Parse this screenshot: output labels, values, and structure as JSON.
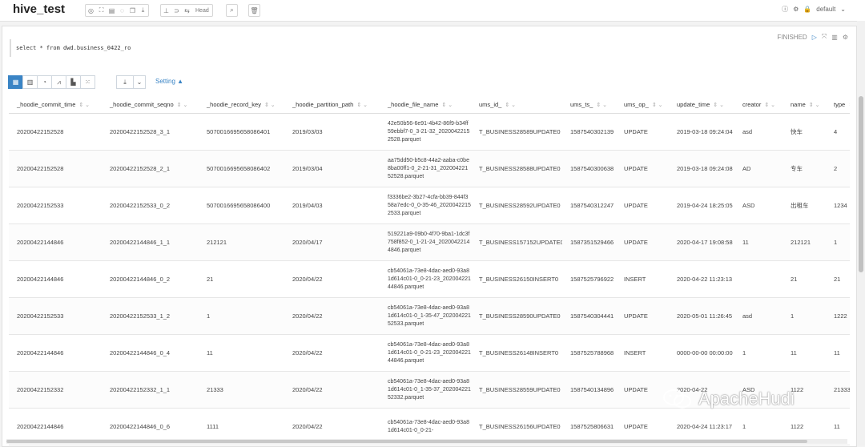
{
  "app": {
    "title": "hive_test"
  },
  "toolbar": {
    "head_label": "Head",
    "user": "default"
  },
  "query": {
    "sql": "select *  from dwd.business_0422_ro",
    "status": "FINISHED"
  },
  "results": {
    "setting_label": "Setting",
    "columns": [
      "_hoodie_commit_time",
      "_hoodie_commit_seqno",
      "_hoodie_record_key",
      "_hoodie_partition_path",
      "_hoodie_file_name",
      "ums_id_",
      "ums_ts_",
      "ums_op_",
      "update_time",
      "creator",
      "name",
      "type"
    ],
    "rows": [
      [
        "20200422152528",
        "20200422152528_3_1",
        "5070016695658086401",
        "2019/03/03",
        "42e50b56-6e91-4b42-86f9-b34ff59ebbf7-0_3-21-32_20200422152528.parquet",
        "T_BUSINESS28589UPDATE0",
        "1587540302139",
        "UPDATE",
        "2019-03-18 09:24:04",
        "asd",
        "快车",
        "4"
      ],
      [
        "20200422152528",
        "20200422152528_2_1",
        "5070016695658086402",
        "2019/03/04",
        "aa75dd50-b5c8-44a2-aaba-c0be8ba00ff1-0_2-21-31_20200422152528.parquet",
        "T_BUSINESS28588UPDATE0",
        "1587540300638",
        "UPDATE",
        "2019-03-18 09:24:08",
        "AD",
        "专车",
        "2"
      ],
      [
        "20200422152533",
        "20200422152533_0_2",
        "5070016695658086400",
        "2019/04/03",
        "f3336be2-3b27-4cfa-bb39-844f358a7edc-0_0-35-46_20200422152533.parquet",
        "T_BUSINESS28592UPDATE0",
        "1587540312247",
        "UPDATE",
        "2019-04-24 18:25:05",
        "ASD",
        "出租车",
        "1234"
      ],
      [
        "20200422144846",
        "20200422144846_1_1",
        "212121",
        "2020/04/17",
        "519221a9-09b0-4f70-9ba1-1dc3f758f852-0_1-21-24_20200422144846.parquet",
        "T_BUSINESS157152UPDATE0",
        "1587351529466",
        "UPDATE",
        "2020-04-17 19:08:58",
        "11",
        "212121",
        "1"
      ],
      [
        "20200422144846",
        "20200422144846_0_2",
        "21",
        "2020/04/22",
        "cb54061a-73e8-4dac-aed0-93a81d614c01-0_0-21-23_20200422144846.parquet",
        "T_BUSINESS26150INSERT0",
        "1587525796922",
        "INSERT",
        "2020-04-22 11:23:13",
        "",
        "21",
        "21"
      ],
      [
        "20200422152533",
        "20200422152533_1_2",
        "1",
        "2020/04/22",
        "cb54061a-73e8-4dac-aed0-93a81d614c01-0_1-35-47_20200422152533.parquet",
        "T_BUSINESS28590UPDATE0",
        "1587540304441",
        "UPDATE",
        "2020-05-01 11:26:45",
        "asd",
        "1",
        "1222"
      ],
      [
        "20200422144846",
        "20200422144846_0_4",
        "11",
        "2020/04/22",
        "cb54061a-73e8-4dac-aed0-93a81d614c01-0_0-21-23_20200422144846.parquet",
        "T_BUSINESS26148INSERT0",
        "1587525788968",
        "INSERT",
        "0000-00-00 00:00:00",
        "1",
        "11",
        "11"
      ],
      [
        "20200422152332",
        "20200422152332_1_1",
        "21333",
        "2020/04/22",
        "cb54061a-73e8-4dac-aed0-93a81d614c01-0_1-35-37_20200422152332.parquet",
        "T_BUSINESS28559UPDATE0",
        "1587540134896",
        "UPDATE",
        "2020-04-22",
        "ASD",
        "1122",
        "21333"
      ],
      [
        "20200422144846",
        "20200422144846_0_6",
        "1111",
        "2020/04/22",
        "cb54061a-73e8-4dac-aed0-93a81d614c01-0_0-21-",
        "T_BUSINESS26156UPDATE0",
        "1587525806631",
        "UPDATE",
        "2020-04-24 11:23:17",
        "1",
        "1122",
        "11"
      ]
    ]
  },
  "watermark": {
    "text": "ApacheHudi"
  }
}
